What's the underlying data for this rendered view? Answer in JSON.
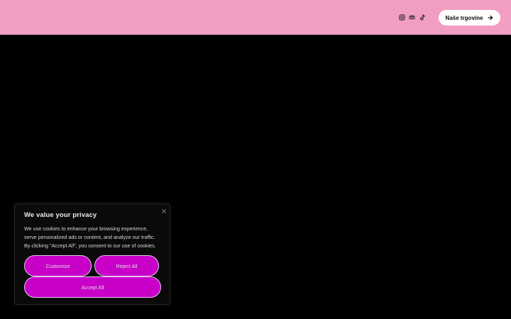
{
  "header": {
    "background": "#f29ec2",
    "social_icons": [
      "instagram-icon",
      "tripadvisor-icon",
      "tiktok-icon"
    ],
    "stores_button": {
      "label": "Naše trgovine",
      "icon": "arrow-right-icon"
    }
  },
  "cookie_banner": {
    "title": "We value your privacy",
    "body_lines": [
      "We use cookies to enhance your browsing experience,",
      "serve personalized ads or content, and analyze our traffic.",
      "By clicking \"Accept All\", you consent to our use of cookies."
    ],
    "buttons": {
      "customize": "Customize",
      "reject": "Reject All",
      "accept": "Accept All"
    },
    "button_color": "#c800c8",
    "close_icon": "close-icon"
  }
}
